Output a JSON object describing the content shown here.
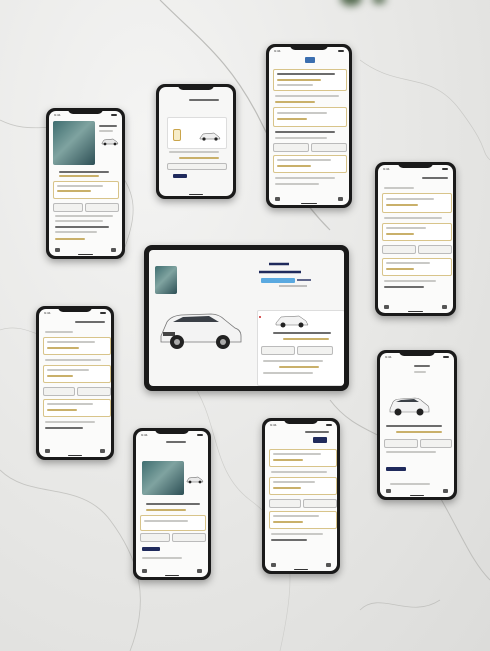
{
  "scene": {
    "subject": "phones-and-tablet-mockup",
    "colors": {
      "marble": "#e7e7e5",
      "device": "#1a1a1a",
      "accent_gold": "#c9b06a",
      "accent_navy": "#1f2a5c",
      "screen_bg": "#fbfbfa"
    }
  },
  "devices": [
    {
      "name": "phone-left-top",
      "screen": "map-and-car"
    },
    {
      "name": "phone-small-top",
      "screen": "car-confirm"
    },
    {
      "name": "phone-top-right",
      "screen": "long-list"
    },
    {
      "name": "phone-right",
      "screen": "list"
    },
    {
      "name": "tablet-center",
      "screen": "brand-and-cars"
    },
    {
      "name": "phone-left-middle",
      "screen": "list"
    },
    {
      "name": "phone-right-bottom",
      "screen": "suv-details"
    },
    {
      "name": "phone-bottom-left",
      "screen": "map-and-car"
    },
    {
      "name": "phone-bottom-center",
      "screen": "list"
    }
  ]
}
